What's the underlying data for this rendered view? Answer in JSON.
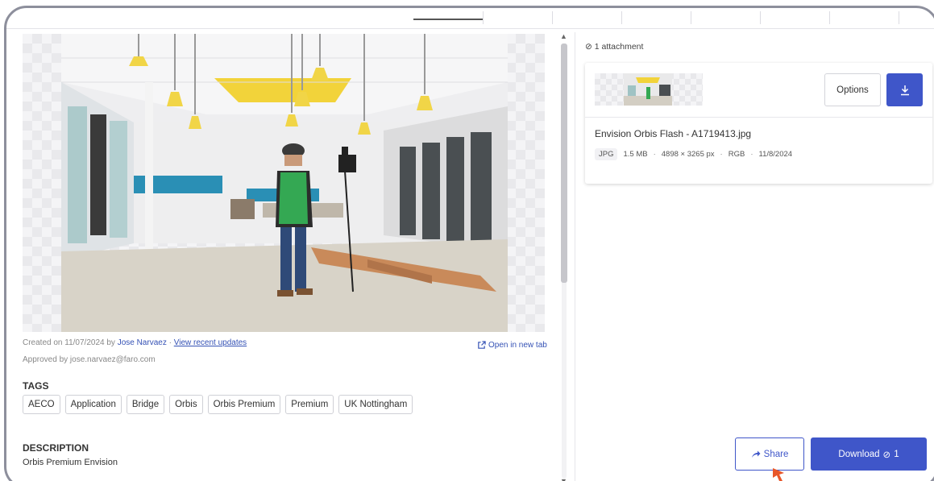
{
  "tabs_bar": {
    "active_index": 0
  },
  "metadata": {
    "created_prefix": "Created on 11/07/2024 by",
    "created_by": "Jose Narvaez",
    "separator": "·",
    "recent_updates_link": "View recent updates",
    "approved_by": "Approved by jose.narvaez@faro.com",
    "open_new_tab": "Open in new tab"
  },
  "tags": {
    "heading": "TAGS",
    "items": [
      "AECO",
      "Application",
      "Bridge",
      "Orbis",
      "Orbis Premium",
      "Premium",
      "UK Nottingham"
    ]
  },
  "description": {
    "heading": "DESCRIPTION",
    "text": "Orbis Premium Envision"
  },
  "attachments": {
    "count_label": "1 attachment",
    "options_label": "Options",
    "file": {
      "name": "Envision Orbis Flash - A1719413.jpg",
      "type": "JPG",
      "size": "1.5 MB",
      "dimensions": "4898 × 3265 px",
      "color_mode": "RGB",
      "date": "11/8/2024"
    }
  },
  "actions": {
    "share_label": "Share",
    "download_label": "Download",
    "download_count": "1"
  },
  "colors": {
    "accent": "#3f56c9",
    "link": "#3552b5",
    "cursor": "#e8572a"
  }
}
